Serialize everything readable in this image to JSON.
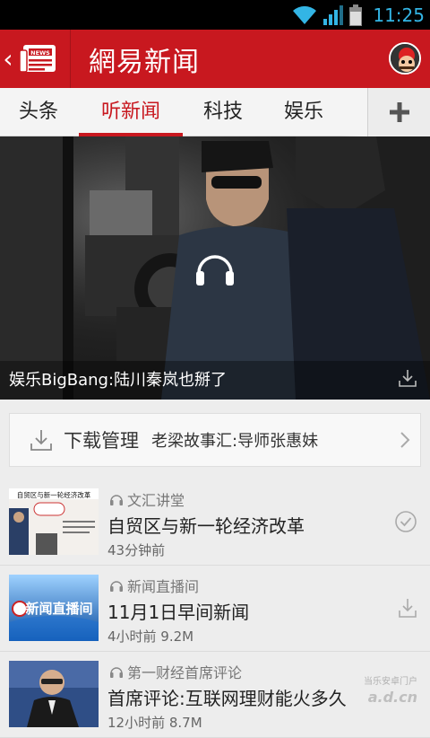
{
  "status": {
    "time": "11:25"
  },
  "header": {
    "title": "網易新闻",
    "logo_text": "NEWS"
  },
  "tabs": [
    {
      "label": "头条"
    },
    {
      "label": "听新闻"
    },
    {
      "label": "科技"
    },
    {
      "label": "娱乐"
    }
  ],
  "hero": {
    "caption": "娱乐BigBang:陆川秦岚也掰了"
  },
  "download_bar": {
    "label": "下载管理",
    "subtitle": "老梁故事汇:导师张惠妹"
  },
  "items": [
    {
      "category": "文汇讲堂",
      "title": "自贸区与新一轮经济改革",
      "meta": "43分钟前",
      "thumb_text": "自贸区与新一轮经济改革"
    },
    {
      "category": "新闻直播间",
      "title": "11月1日早间新闻",
      "meta": "4小时前 9.2M",
      "thumb_text": "新闻直播间"
    },
    {
      "category": "第一财经首席评论",
      "title": "首席评论:互联网理财能火多久",
      "meta": "12小时前 8.7M"
    }
  ],
  "watermark": {
    "text": "a.d.cn",
    "sub": "当乐安卓门户"
  },
  "colors": {
    "brand_red": "#c8181f",
    "status_blue": "#33b5e5"
  }
}
